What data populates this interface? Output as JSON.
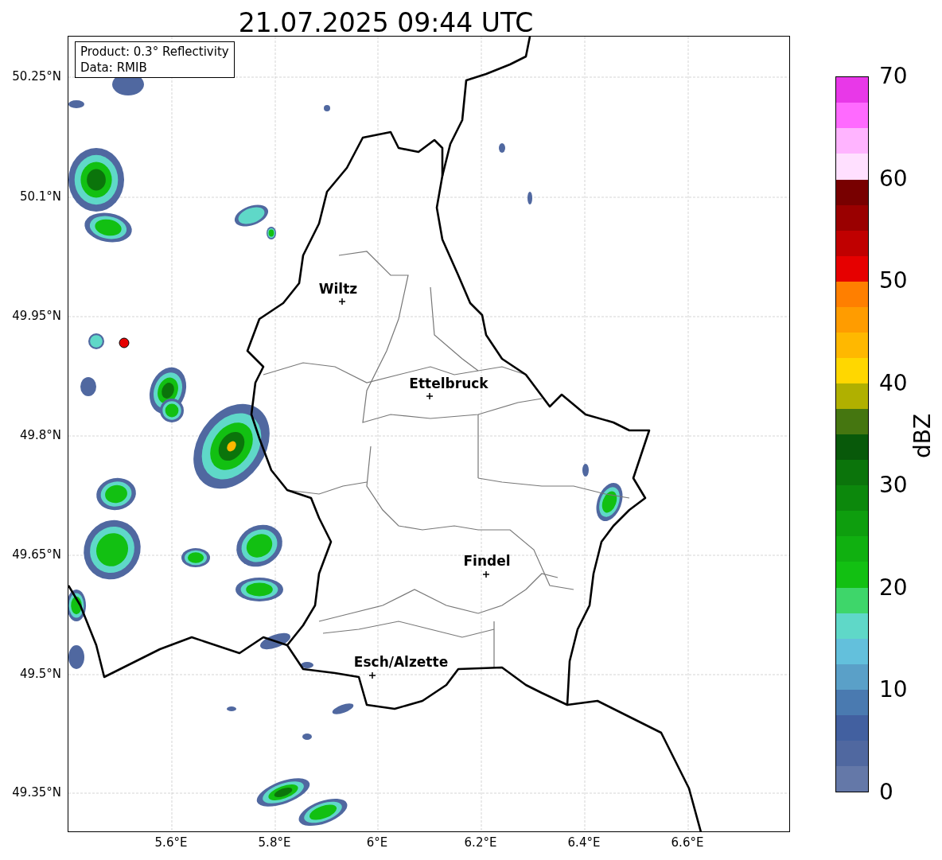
{
  "title": "21.07.2025 09:44 UTC",
  "info_box": [
    "Product: 0.3° Reflectivity",
    "Data: RMIB"
  ],
  "map": {
    "kind": "map",
    "cities": [
      {
        "name": "Wiltz"
      },
      {
        "name": "Ettelbruck"
      },
      {
        "name": "Findel"
      },
      {
        "name": "Esch/Alzette"
      }
    ],
    "lat_ticks": [
      "50.25°N",
      "50.1°N",
      "49.95°N",
      "49.8°N",
      "49.65°N",
      "49.5°N",
      "49.35°N"
    ],
    "lon_ticks": [
      "5.6°E",
      "5.8°E",
      "6°E",
      "6.2°E",
      "6.4°E",
      "6.6°E"
    ]
  },
  "colorbar": {
    "label": "dBZ",
    "ticks": [
      "70",
      "60",
      "50",
      "40",
      "30",
      "20",
      "10",
      "0"
    ],
    "segments": [
      {
        "color": "#6478a8"
      },
      {
        "color": "#5068a0"
      },
      {
        "color": "#4260a0"
      },
      {
        "color": "#4a7ab0"
      },
      {
        "color": "#5aa0c8"
      },
      {
        "color": "#63c0dc"
      },
      {
        "color": "#5fd8c8"
      },
      {
        "color": "#3ed66a"
      },
      {
        "color": "#12c012"
      },
      {
        "color": "#10b010"
      },
      {
        "color": "#0e9e0e"
      },
      {
        "color": "#0c880c"
      },
      {
        "color": "#0b740b"
      },
      {
        "color": "#08590a"
      },
      {
        "color": "#457610"
      },
      {
        "color": "#b0b000"
      },
      {
        "color": "#ffd700"
      },
      {
        "color": "#ffb800"
      },
      {
        "color": "#ff9c00"
      },
      {
        "color": "#ff7f00"
      },
      {
        "color": "#e60000"
      },
      {
        "color": "#c00000"
      },
      {
        "color": "#9a0000"
      },
      {
        "color": "#780000"
      },
      {
        "color": "#ffe0ff"
      },
      {
        "color": "#ffb4ff"
      },
      {
        "color": "#ff6aff"
      },
      {
        "color": "#e838e8"
      }
    ]
  }
}
